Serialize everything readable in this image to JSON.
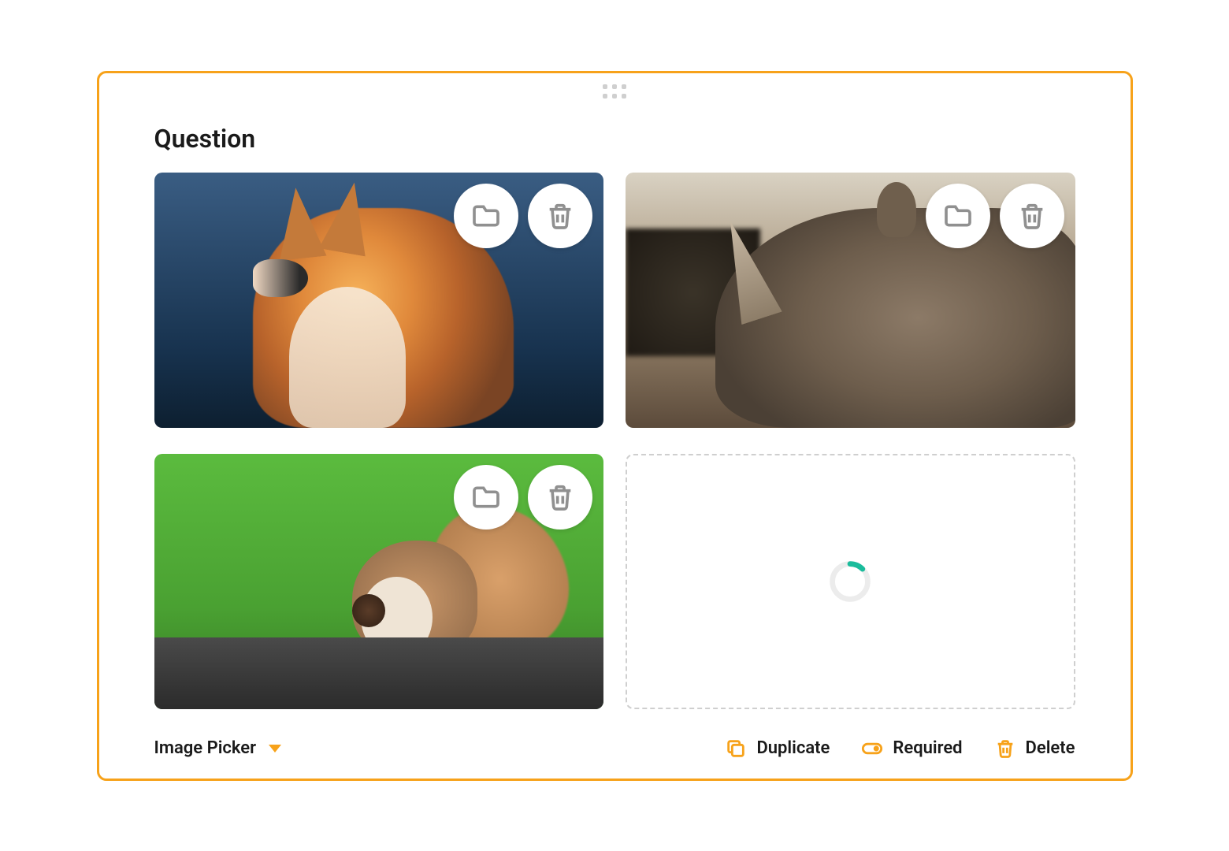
{
  "question": {
    "title": "Question",
    "type_label": "Image Picker",
    "images": [
      {
        "alt": "fox"
      },
      {
        "alt": "rhinoceros"
      },
      {
        "alt": "squirrel"
      }
    ],
    "loading_slot": true
  },
  "image_actions": {
    "browse_label": "Browse",
    "delete_label": "Delete"
  },
  "footer": {
    "duplicate": "Duplicate",
    "required": "Required",
    "delete": "Delete"
  },
  "colors": {
    "accent": "#f7a21a",
    "spinner": "#1abc9c"
  }
}
